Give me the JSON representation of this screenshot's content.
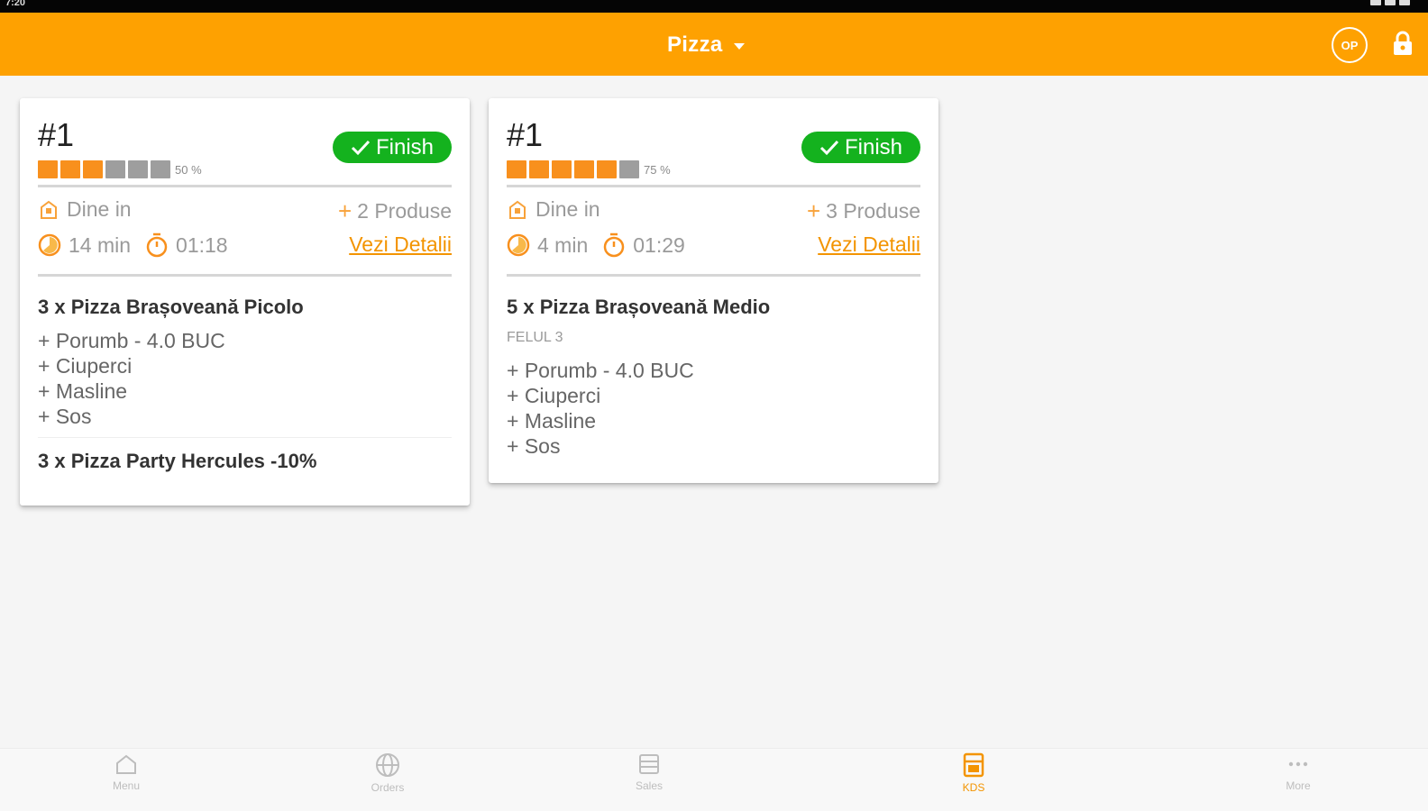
{
  "status_bar": {
    "time": "7:20"
  },
  "app_bar": {
    "station": "Pizza",
    "user_initials": "OP"
  },
  "orders": [
    {
      "number": "#1",
      "progress_percent": 50,
      "progress_text": "50 %",
      "finish_label": "Finish",
      "service_type": "Dine in",
      "products_count": "2 Produse",
      "elapsed": "14 min",
      "timer": "01:18",
      "details_label": "Vezi Detalii",
      "items": [
        {
          "title": "3 x Pizza Brașoveană Picolo",
          "modifiers": [
            "+ Porumb - 4.0 BUC",
            "+ Ciuperci",
            "+ Masline",
            "+ Sos"
          ]
        },
        {
          "title": "3 x Pizza Party Hercules -10%",
          "modifiers": []
        }
      ]
    },
    {
      "number": "#1",
      "progress_percent": 75,
      "progress_text": "75 %",
      "finish_label": "Finish",
      "service_type": "Dine in",
      "products_count": "3 Produse",
      "elapsed": "4 min",
      "timer": "01:29",
      "details_label": "Vezi Detalii",
      "items": [
        {
          "title": "5 x Pizza Brașoveană Medio",
          "course": "FELUL 3",
          "modifiers": [
            "+ Porumb - 4.0 BUC",
            "+ Ciuperci",
            "+ Masline",
            "+ Sos"
          ]
        }
      ]
    }
  ],
  "bottom_nav": [
    {
      "label": "Menu",
      "icon": "home-icon"
    },
    {
      "label": "Orders",
      "icon": "globe-icon"
    },
    {
      "label": "Sales",
      "icon": "sales-icon"
    },
    {
      "label": "KDS",
      "icon": "kds-icon",
      "active": true
    },
    {
      "label": "More",
      "icon": "more-icon"
    }
  ],
  "colors": {
    "brand": "#fea101",
    "finish": "#14b21e",
    "progress_on": "#f8901d",
    "progress_off": "#9e9e9e",
    "link": "#f39400"
  }
}
